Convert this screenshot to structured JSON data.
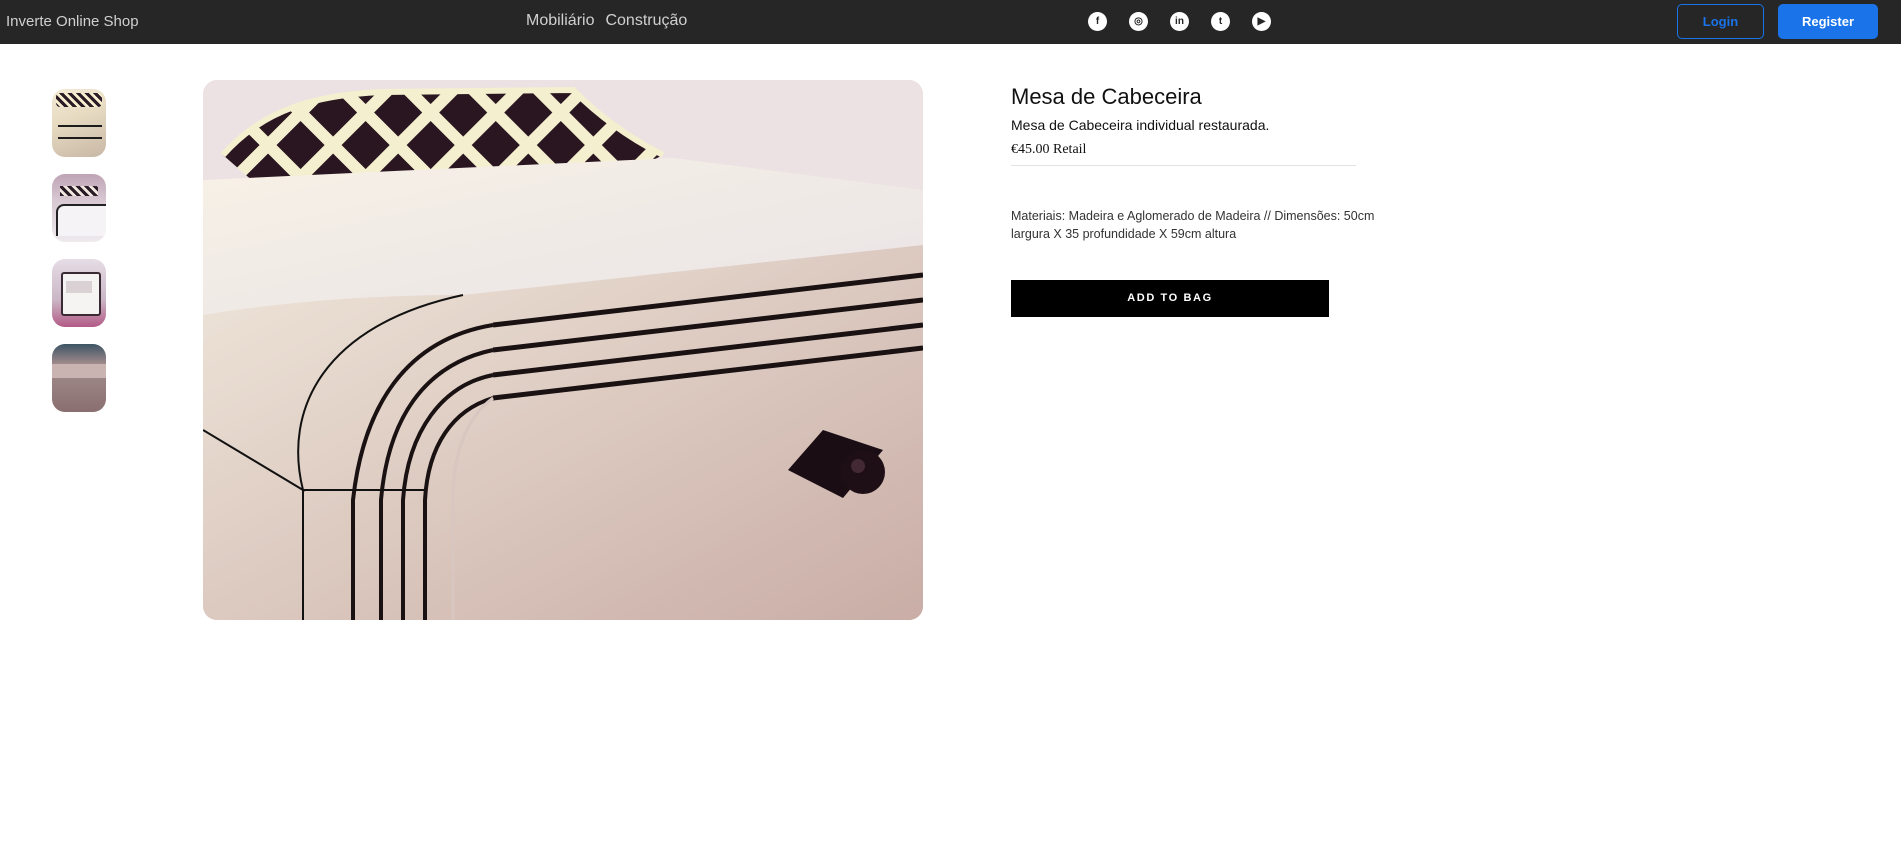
{
  "header": {
    "brand": "Inverte Online Shop",
    "nav": [
      "Mobiliário",
      "Construção"
    ],
    "social": [
      {
        "name": "facebook-icon",
        "glyph": "f"
      },
      {
        "name": "instagram-icon",
        "glyph": "◎"
      },
      {
        "name": "linkedin-icon",
        "glyph": "in"
      },
      {
        "name": "twitter-icon",
        "glyph": "t"
      },
      {
        "name": "youtube-icon",
        "glyph": "▶"
      }
    ],
    "login_label": "Login",
    "register_label": "Register",
    "accent_color": "#1a73e8",
    "bar_color": "#262626"
  },
  "product": {
    "title": "Mesa de Cabeceira",
    "subtitle": "Mesa de Cabeceira individual restaurada.",
    "price": "€45.00 Retail",
    "description": "Materiais: Madeira e Aglomerado de Madeira // Dimensões: 50cm largura X 35 profundidade X 59cm altura",
    "add_to_bag_label": "ADD TO BAG"
  }
}
